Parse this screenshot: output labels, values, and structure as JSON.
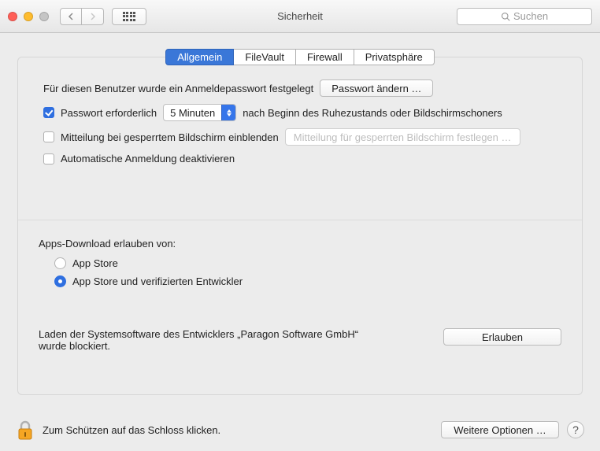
{
  "window": {
    "title": "Sicherheit"
  },
  "search": {
    "placeholder": "Suchen"
  },
  "tabs": {
    "general": "Allgemein",
    "filevault": "FileVault",
    "firewall": "Firewall",
    "privacy": "Privatsphäre"
  },
  "general": {
    "pw_set_text": "Für diesen Benutzer wurde ein Anmeldepasswort festgelegt",
    "change_pw_btn": "Passwort ändern …",
    "require_pw_label": "Passwort erforderlich",
    "require_pw_delay": "5 Minuten",
    "require_pw_after": "nach Beginn des Ruhezustands oder Bildschirmschoners",
    "show_message_label": "Mitteilung bei gesperrtem Bildschirm einblenden",
    "show_message_placeholder": "Mitteilung für gesperrten Bildschirm festlegen …",
    "disable_autologin_label": "Automatische Anmeldung deaktivieren",
    "allow_apps_heading": "Apps-Download erlauben von:",
    "radio_appstore": "App Store",
    "radio_identified": "App Store und verifizierten Entwickler",
    "blocked_text": "Laden der Systemsoftware des Entwicklers „Paragon Software GmbH“ wurde blockiert.",
    "allow_btn": "Erlauben"
  },
  "footer": {
    "lock_hint": "Zum Schützen auf das Schloss klicken.",
    "advanced_btn": "Weitere Optionen …",
    "help": "?"
  }
}
